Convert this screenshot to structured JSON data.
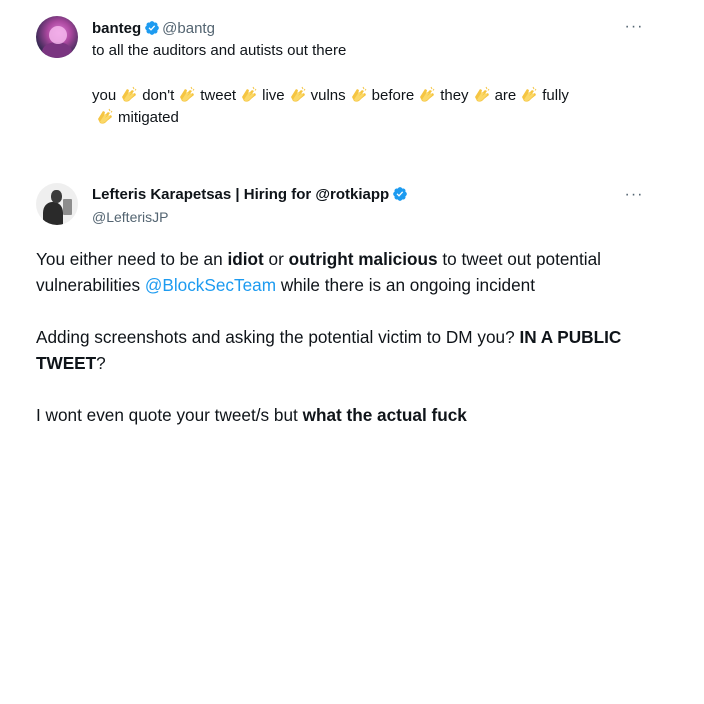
{
  "tweet1": {
    "display_name": "banteg",
    "handle": "@bantg",
    "more_label": "···",
    "intro": "to all the auditors and autists out there",
    "clap_words_line1": [
      "you",
      "don't",
      "tweet",
      "live",
      "vulns",
      "before",
      "they",
      "are",
      "fully"
    ],
    "clap_words_line2": [
      "mitigated"
    ],
    "clap_icon": "clapping-hands-icon"
  },
  "tweet2": {
    "display_name": "Lefteris Karapetsas | Hiring for @rotkiapp",
    "handle": "@LefterisJP",
    "more_label": "···",
    "p1": {
      "s1": "You either need to be an ",
      "b1": "idiot",
      "s2": " or ",
      "b2": "outright malicious",
      "s3": " to tweet out potential vulnerabilities ",
      "mention": "@BlockSecTeam",
      "s4": " while there is an ongoing incident"
    },
    "p2": {
      "s1": "Adding screenshots and asking the potential victim to DM you? ",
      "b1": "IN A PUBLIC TWEET",
      "s2": "?"
    },
    "p3": {
      "s1": "I wont even quote your tweet/s but ",
      "b1": "what the actual fuck"
    }
  },
  "colors": {
    "text": "#0f1419",
    "secondary": "#536471",
    "link": "#1d9bf0",
    "verified": "#1d9bf0"
  }
}
